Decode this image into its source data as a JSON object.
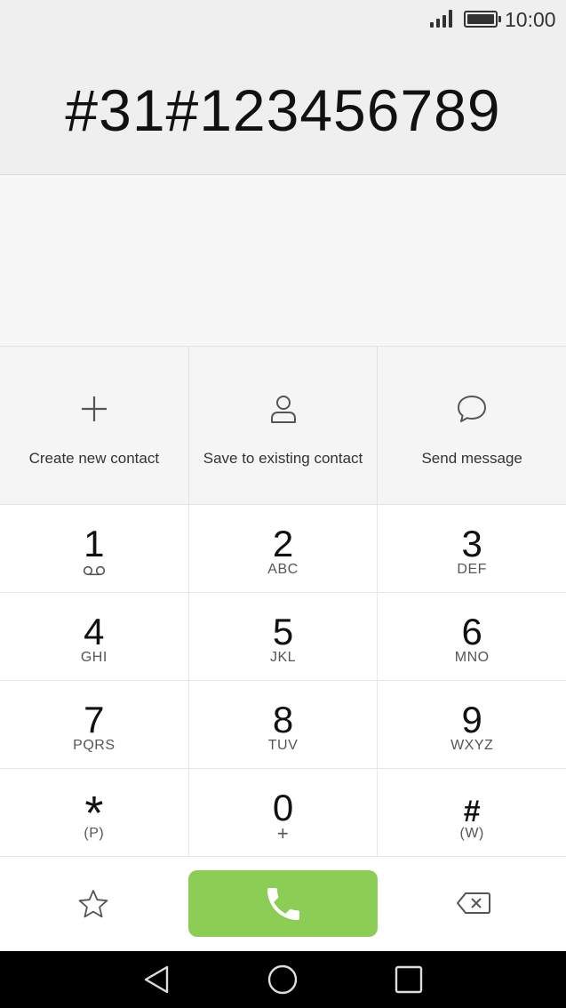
{
  "status_bar": {
    "time": "10:00",
    "icons": [
      "signal-icon",
      "battery-icon"
    ]
  },
  "dialer": {
    "number": "#31#123456789"
  },
  "actions": [
    {
      "label": "Create new contact",
      "icon": "plus-icon"
    },
    {
      "label": "Save to existing contact",
      "icon": "person-icon"
    },
    {
      "label": "Send message",
      "icon": "chat-bubble-icon"
    }
  ],
  "keypad": [
    {
      "digit": "1",
      "letters": "",
      "icon": "voicemail-icon"
    },
    {
      "digit": "2",
      "letters": "ABC"
    },
    {
      "digit": "3",
      "letters": "DEF"
    },
    {
      "digit": "4",
      "letters": "GHI"
    },
    {
      "digit": "5",
      "letters": "JKL"
    },
    {
      "digit": "6",
      "letters": "MNO"
    },
    {
      "digit": "7",
      "letters": "PQRS"
    },
    {
      "digit": "8",
      "letters": "TUV"
    },
    {
      "digit": "9",
      "letters": "WXYZ"
    },
    {
      "digit": "*",
      "letters": "(P)"
    },
    {
      "digit": "0",
      "letters": "+"
    },
    {
      "digit": "#",
      "letters": "(W)"
    }
  ],
  "bottom_bar": {
    "icons": [
      "star-icon",
      "phone-icon",
      "backspace-icon"
    ],
    "call_color": "#8ccd55"
  },
  "nav_bar": {
    "icons": [
      "back-triangle-icon",
      "home-circle-icon",
      "recents-square-icon"
    ]
  }
}
